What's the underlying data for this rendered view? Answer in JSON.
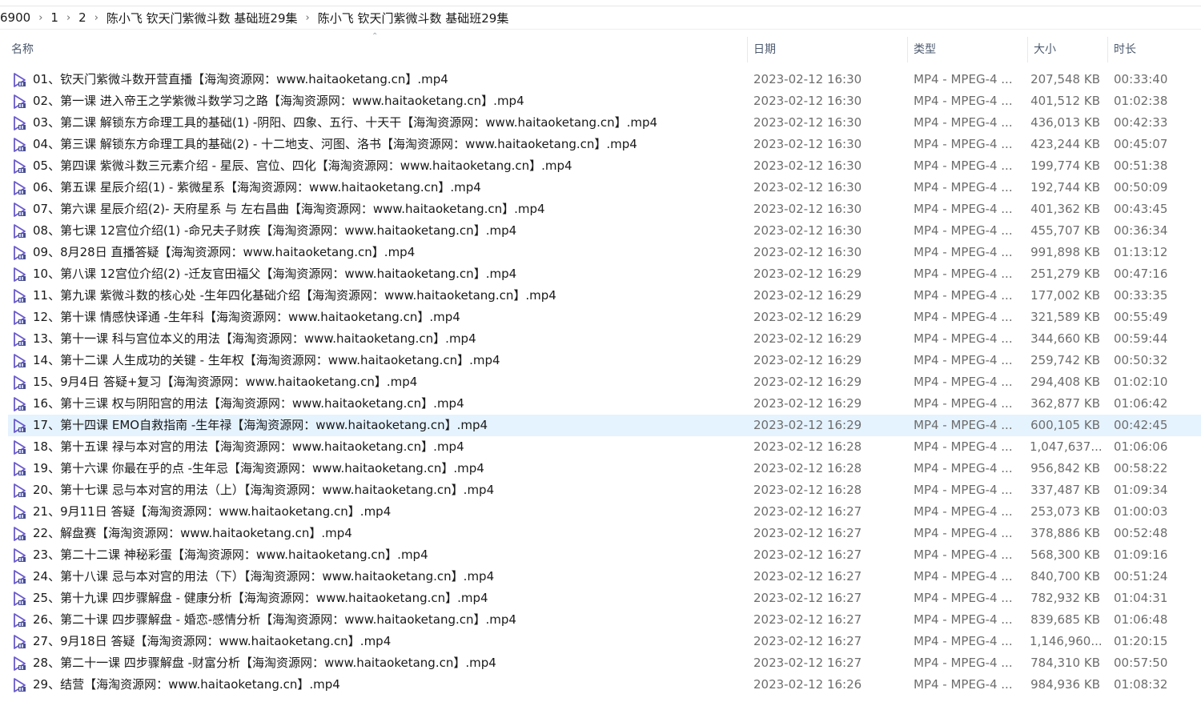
{
  "breadcrumb": [
    "6900",
    "1",
    "2",
    "陈小飞 钦天门紫微斗数 基础班29集",
    "陈小飞 钦天门紫微斗数 基础班29集"
  ],
  "columns": {
    "name": "名称",
    "date": "日期",
    "type": "类型",
    "size": "大小",
    "duration": "时长"
  },
  "selected_index": 16,
  "icon": "video-play-file-icon",
  "colors": {
    "selected": "#e5f3ff",
    "icon": "#6a5acd"
  },
  "files": [
    {
      "name": "01、钦天门紫微斗数开营直播【海淘资源网：www.haitaoketang.cn】.mp4",
      "date": "2023-02-12 16:30",
      "type": "MP4 - MPEG-4 ...",
      "size": "207,548 KB",
      "duration": "00:33:40"
    },
    {
      "name": "02、第一课 进入帝王之学紫微斗数学习之路【海淘资源网：www.haitaoketang.cn】.mp4",
      "date": "2023-02-12 16:30",
      "type": "MP4 - MPEG-4 ...",
      "size": "401,512 KB",
      "duration": "01:02:38"
    },
    {
      "name": "03、第二课 解锁东方命理工具的基础(1) -阴阳、四象、五行、十天干【海淘资源网：www.haitaoketang.cn】.mp4",
      "date": "2023-02-12 16:30",
      "type": "MP4 - MPEG-4 ...",
      "size": "436,013 KB",
      "duration": "00:42:33"
    },
    {
      "name": "04、第三课 解锁东方命理工具的基础(2) - 十二地支、河图、洛书【海淘资源网：www.haitaoketang.cn】.mp4",
      "date": "2023-02-12 16:30",
      "type": "MP4 - MPEG-4 ...",
      "size": "423,244 KB",
      "duration": "00:45:07"
    },
    {
      "name": "05、第四课 紫微斗数三元素介绍 - 星辰、宫位、四化【海淘资源网：www.haitaoketang.cn】.mp4",
      "date": "2023-02-12 16:30",
      "type": "MP4 - MPEG-4 ...",
      "size": "199,774 KB",
      "duration": "00:51:38"
    },
    {
      "name": "06、第五课 星辰介绍(1) - 紫微星系【海淘资源网：www.haitaoketang.cn】.mp4",
      "date": "2023-02-12 16:30",
      "type": "MP4 - MPEG-4 ...",
      "size": "192,744 KB",
      "duration": "00:50:09"
    },
    {
      "name": "07、第六课 星辰介绍(2)- 天府星系 与 左右昌曲【海淘资源网：www.haitaoketang.cn】.mp4",
      "date": "2023-02-12 16:30",
      "type": "MP4 - MPEG-4 ...",
      "size": "401,362 KB",
      "duration": "00:43:45"
    },
    {
      "name": "08、第七课 12宫位介绍(1) -命兄夫子财疾【海淘资源网：www.haitaoketang.cn】.mp4",
      "date": "2023-02-12 16:30",
      "type": "MP4 - MPEG-4 ...",
      "size": "455,707 KB",
      "duration": "00:36:34"
    },
    {
      "name": "09、8月28日 直播答疑【海淘资源网：www.haitaoketang.cn】.mp4",
      "date": "2023-02-12 16:30",
      "type": "MP4 - MPEG-4 ...",
      "size": "991,898 KB",
      "duration": "01:13:12"
    },
    {
      "name": "10、第八课 12宫位介绍(2) -迁友官田福父【海淘资源网：www.haitaoketang.cn】.mp4",
      "date": "2023-02-12 16:29",
      "type": "MP4 - MPEG-4 ...",
      "size": "251,279 KB",
      "duration": "00:47:16"
    },
    {
      "name": "11、第九课 紫微斗数的核心处 -生年四化基础介绍【海淘资源网：www.haitaoketang.cn】.mp4",
      "date": "2023-02-12 16:29",
      "type": "MP4 - MPEG-4 ...",
      "size": "177,002 KB",
      "duration": "00:33:35"
    },
    {
      "name": "12、第十课 情感快译通 -生年科【海淘资源网：www.haitaoketang.cn】.mp4",
      "date": "2023-02-12 16:29",
      "type": "MP4 - MPEG-4 ...",
      "size": "321,589 KB",
      "duration": "00:55:49"
    },
    {
      "name": "13、第十一课 科与宫位本义的用法【海淘资源网：www.haitaoketang.cn】.mp4",
      "date": "2023-02-12 16:29",
      "type": "MP4 - MPEG-4 ...",
      "size": "344,660 KB",
      "duration": "00:59:44"
    },
    {
      "name": "14、第十二课 人生成功的关键 - 生年权【海淘资源网：www.haitaoketang.cn】.mp4",
      "date": "2023-02-12 16:29",
      "type": "MP4 - MPEG-4 ...",
      "size": "259,742 KB",
      "duration": "00:50:32"
    },
    {
      "name": "15、9月4日 答疑+复习【海淘资源网：www.haitaoketang.cn】.mp4",
      "date": "2023-02-12 16:29",
      "type": "MP4 - MPEG-4 ...",
      "size": "294,408 KB",
      "duration": "01:02:10"
    },
    {
      "name": "16、第十三课 权与阴阳宫的用法【海淘资源网：www.haitaoketang.cn】.mp4",
      "date": "2023-02-12 16:29",
      "type": "MP4 - MPEG-4 ...",
      "size": "362,877 KB",
      "duration": "01:06:42"
    },
    {
      "name": "17、第十四课 EMO自救指南 -生年禄【海淘资源网：www.haitaoketang.cn】.mp4",
      "date": "2023-02-12 16:29",
      "type": "MP4 - MPEG-4 ...",
      "size": "600,105 KB",
      "duration": "00:42:45"
    },
    {
      "name": "18、第十五课 禄与本对宫的用法【海淘资源网：www.haitaoketang.cn】.mp4",
      "date": "2023-02-12 16:28",
      "type": "MP4 - MPEG-4 ...",
      "size": "1,047,637...",
      "duration": "01:06:06"
    },
    {
      "name": "19、第十六课 你最在乎的点 -生年忌【海淘资源网：www.haitaoketang.cn】.mp4",
      "date": "2023-02-12 16:28",
      "type": "MP4 - MPEG-4 ...",
      "size": "956,842 KB",
      "duration": "00:58:22"
    },
    {
      "name": "20、第十七课 忌与本对宫的用法（上）【海淘资源网：www.haitaoketang.cn】.mp4",
      "date": "2023-02-12 16:28",
      "type": "MP4 - MPEG-4 ...",
      "size": "337,487 KB",
      "duration": "01:09:34"
    },
    {
      "name": "21、9月11日 答疑【海淘资源网：www.haitaoketang.cn】.mp4",
      "date": "2023-02-12 16:27",
      "type": "MP4 - MPEG-4 ...",
      "size": "253,073 KB",
      "duration": "01:00:03"
    },
    {
      "name": "22、解盘赛【海淘资源网：www.haitaoketang.cn】.mp4",
      "date": "2023-02-12 16:27",
      "type": "MP4 - MPEG-4 ...",
      "size": "378,886 KB",
      "duration": "00:52:48"
    },
    {
      "name": "23、第二十二课 神秘彩蛋【海淘资源网：www.haitaoketang.cn】.mp4",
      "date": "2023-02-12 16:27",
      "type": "MP4 - MPEG-4 ...",
      "size": "568,300 KB",
      "duration": "01:09:16"
    },
    {
      "name": "24、第十八课 忌与本对宫的用法（下）【海淘资源网：www.haitaoketang.cn】.mp4",
      "date": "2023-02-12 16:27",
      "type": "MP4 - MPEG-4 ...",
      "size": "840,700 KB",
      "duration": "00:51:24"
    },
    {
      "name": "25、第十九课 四步骤解盘 - 健康分析【海淘资源网：www.haitaoketang.cn】.mp4",
      "date": "2023-02-12 16:27",
      "type": "MP4 - MPEG-4 ...",
      "size": "782,932 KB",
      "duration": "01:04:31"
    },
    {
      "name": "26、第二十课 四步骤解盘 - 婚恋-感情分析【海淘资源网：www.haitaoketang.cn】.mp4",
      "date": "2023-02-12 16:27",
      "type": "MP4 - MPEG-4 ...",
      "size": "839,685 KB",
      "duration": "01:06:48"
    },
    {
      "name": "27、9月18日 答疑【海淘资源网：www.haitaoketang.cn】.mp4",
      "date": "2023-02-12 16:27",
      "type": "MP4 - MPEG-4 ...",
      "size": "1,146,960...",
      "duration": "01:20:15"
    },
    {
      "name": "28、第二十一课 四步骤解盘 -财富分析【海淘资源网：www.haitaoketang.cn】.mp4",
      "date": "2023-02-12 16:27",
      "type": "MP4 - MPEG-4 ...",
      "size": "784,310 KB",
      "duration": "00:57:50"
    },
    {
      "name": "29、结营【海淘资源网：www.haitaoketang.cn】.mp4",
      "date": "2023-02-12 16:26",
      "type": "MP4 - MPEG-4 ...",
      "size": "984,936 KB",
      "duration": "01:08:32"
    }
  ]
}
